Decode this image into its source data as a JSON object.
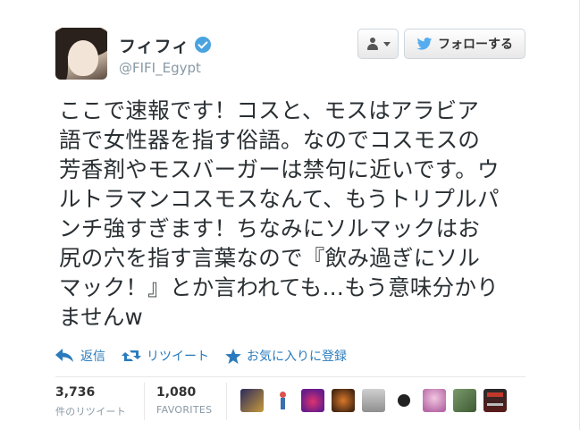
{
  "user": {
    "display_name": "フィフィ",
    "handle": "@FIFI_Egypt"
  },
  "buttons": {
    "follow_label": "フォローする"
  },
  "tweet": {
    "text": "ここで速報です！コスと、モスはアラビア\n語で女性器を指す俗語。なのでコスモスの\n芳香剤やモスバーガーは禁句に近いです。ウ\nルトラマンコスモスなんて、もうトリプルパ\nンチ強すぎます！ちなみにソルマックはお\n尻の穴を指す言葉なので『飲み過ぎにソル\nマック！』とか言われても…もう意味分かり\nませんw"
  },
  "actions": {
    "reply": "返信",
    "retweet": "リツイート",
    "favorite": "お気に入りに登録"
  },
  "stats": {
    "retweets_count": "3,736",
    "retweets_label": "件のリツイート",
    "favorites_count": "1,080",
    "favorites_label": "FAVORITES"
  },
  "colors": {
    "link": "#2a7bbd",
    "verified": "#4aa3df",
    "twitter_blue": "#55acee"
  }
}
